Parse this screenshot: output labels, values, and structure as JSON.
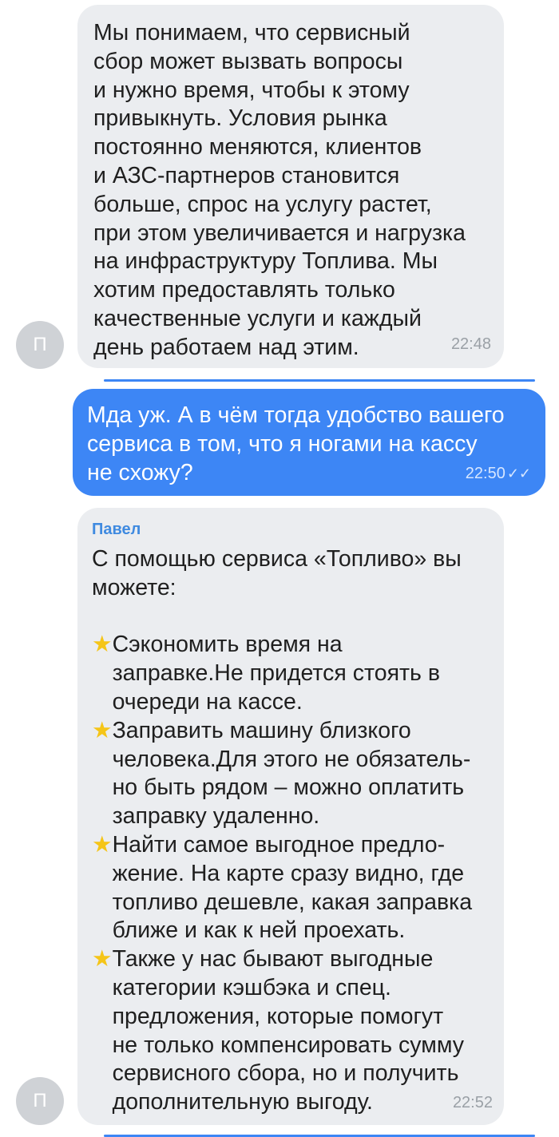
{
  "messages": [
    {
      "direction": "in",
      "avatar_letter": "П",
      "text": "Мы понимаем, что сервисный\nсбор может вызвать вопросы\nи нужно время, чтобы к этому\nпривыкнуть. Условия рынка\nпостоянно меняются, клиентов\nи АЗС-партнеров становится\nбольше, спрос на услугу растет,\nпри этом увеличивается и нагрузка\nна инфраструктуру Топлива. Мы\nхотим предоставлять только\nкачественные услуги и каждый\nдень работаем над этим.",
      "time": "22:48"
    },
    {
      "direction": "out",
      "text": "Мда уж. А в чём тогда удобство вашего\nсервиса в том, что я ногами на кассу\nне схожу?",
      "time": "22:50",
      "read_icon": "double-check-icon"
    },
    {
      "direction": "in",
      "avatar_letter": "П",
      "sender": "Павел",
      "intro": "С помощью сервиса «Топливо» вы\nможете:",
      "items": [
        "Сэкономить время на\nзаправке.Не придется стоять в\nочереди на кассе.",
        "Заправить машину близкого\nчеловека.Для этого не обязатель-\nно быть рядом – можно оплатить\nзаправку удаленно.",
        "Найти самое выгодное предло-\nжение. На карте сразу видно, где\nтопливо дешевле, какая заправка\nближе и как к ней проехать.",
        "Также у нас бывают выгодные\nкатегории кэшбэка и спец.\nпредложения, которые помогут\nне только компенсировать сумму\nсервисного сбора, но и получить\nдополнительную выгоду."
      ],
      "item_icon": "star-icon",
      "time": "22:52"
    }
  ],
  "colors": {
    "incoming_bubble": "#ebedf0",
    "outgoing_bubble": "#3d86f5",
    "sender_name": "#3f8ae0",
    "star": "#f5c518"
  }
}
